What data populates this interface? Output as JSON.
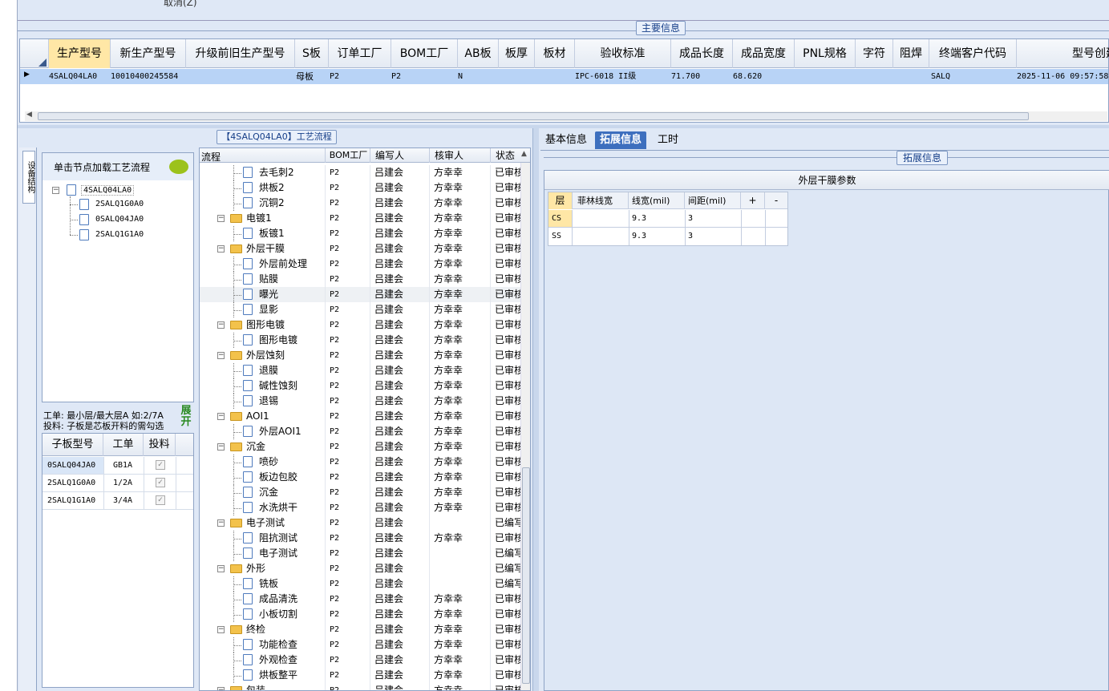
{
  "topbar": {
    "cancel_label": "取消(Z)"
  },
  "main_info": {
    "group_title": "主要信息",
    "columns": [
      "生产型号",
      "新生产型号",
      "升级前旧生产型号",
      "S板",
      "订单工厂",
      "BOM工厂",
      "AB板",
      "板厚",
      "板材",
      "验收标准",
      "成品长度",
      "成品宽度",
      "PNL规格",
      "字符",
      "阻焊",
      "终端客户代码",
      "型号创建日"
    ],
    "row": [
      "4SALQ04LA0",
      "10010400245584",
      "",
      "母板",
      "P2",
      "P2",
      "N",
      "",
      "",
      "IPC-6018 II级",
      "71.700",
      "68.620",
      "",
      "",
      "",
      "SALQ",
      "2025-11-06 09:57:58"
    ]
  },
  "flow_group_title": "【4SALQ04LA0】工艺流程",
  "left_panel": {
    "vertical_tab": "设备结构",
    "load_hint": "单击节点加载工艺流程",
    "tree": {
      "root": "4SALQ04LA0",
      "children": [
        "2SALQ1G0A0",
        "0SALQ04JA0",
        "2SALQ1G1A0"
      ]
    },
    "note_line1": "工单: 最小层/最大层A 如:2/7A",
    "note_line2": "投料: 子板是芯板开料的需勾选",
    "expand_label": "展开",
    "sub_columns": [
      "子板型号",
      "工单",
      "投料"
    ],
    "sub_rows": [
      {
        "model": "0SALQ04JA0",
        "order": "GB1A"
      },
      {
        "model": "2SALQ1G0A0",
        "order": "1/2A"
      },
      {
        "model": "2SALQ1G1A0",
        "order": "3/4A"
      }
    ]
  },
  "flow": {
    "columns": [
      "流程",
      "BOM工厂",
      "编写人",
      "核审人",
      "状态"
    ],
    "rows": [
      {
        "level": 2,
        "name": "去毛刺2",
        "bom": "P2",
        "writer": "吕建会",
        "reviewer": "方幸幸",
        "status": "已审核"
      },
      {
        "level": 2,
        "name": "烘板2",
        "bom": "P2",
        "writer": "吕建会",
        "reviewer": "方幸幸",
        "status": "已审核"
      },
      {
        "level": 2,
        "name": "沉铜2",
        "bom": "P2",
        "writer": "吕建会",
        "reviewer": "方幸幸",
        "status": "已审核"
      },
      {
        "level": 1,
        "name": "电镀1",
        "bom": "P2",
        "writer": "吕建会",
        "reviewer": "方幸幸",
        "status": "已审核"
      },
      {
        "level": 2,
        "name": "板镀1",
        "bom": "P2",
        "writer": "吕建会",
        "reviewer": "方幸幸",
        "status": "已审核"
      },
      {
        "level": 1,
        "name": "外层干膜",
        "bom": "P2",
        "writer": "吕建会",
        "reviewer": "方幸幸",
        "status": "已审核"
      },
      {
        "level": 2,
        "name": "外层前处理",
        "bom": "P2",
        "writer": "吕建会",
        "reviewer": "方幸幸",
        "status": "已审核"
      },
      {
        "level": 2,
        "name": "贴膜",
        "bom": "P2",
        "writer": "吕建会",
        "reviewer": "方幸幸",
        "status": "已审核"
      },
      {
        "level": 2,
        "name": "曝光",
        "bom": "P2",
        "writer": "吕建会",
        "reviewer": "方幸幸",
        "status": "已审核",
        "selected": true
      },
      {
        "level": 2,
        "name": "显影",
        "bom": "P2",
        "writer": "吕建会",
        "reviewer": "方幸幸",
        "status": "已审核"
      },
      {
        "level": 1,
        "name": "图形电镀",
        "bom": "P2",
        "writer": "吕建会",
        "reviewer": "方幸幸",
        "status": "已审核"
      },
      {
        "level": 2,
        "name": "图形电镀",
        "bom": "P2",
        "writer": "吕建会",
        "reviewer": "方幸幸",
        "status": "已审核"
      },
      {
        "level": 1,
        "name": "外层蚀刻",
        "bom": "P2",
        "writer": "吕建会",
        "reviewer": "方幸幸",
        "status": "已审核"
      },
      {
        "level": 2,
        "name": "退膜",
        "bom": "P2",
        "writer": "吕建会",
        "reviewer": "方幸幸",
        "status": "已审核"
      },
      {
        "level": 2,
        "name": "碱性蚀刻",
        "bom": "P2",
        "writer": "吕建会",
        "reviewer": "方幸幸",
        "status": "已审核"
      },
      {
        "level": 2,
        "name": "退锡",
        "bom": "P2",
        "writer": "吕建会",
        "reviewer": "方幸幸",
        "status": "已审核"
      },
      {
        "level": 1,
        "name": "AOI1",
        "bom": "P2",
        "writer": "吕建会",
        "reviewer": "方幸幸",
        "status": "已审核"
      },
      {
        "level": 2,
        "name": "外层AOI1",
        "bom": "P2",
        "writer": "吕建会",
        "reviewer": "方幸幸",
        "status": "已审核"
      },
      {
        "level": 1,
        "name": "沉金",
        "bom": "P2",
        "writer": "吕建会",
        "reviewer": "方幸幸",
        "status": "已审核"
      },
      {
        "level": 2,
        "name": "喷砂",
        "bom": "P2",
        "writer": "吕建会",
        "reviewer": "方幸幸",
        "status": "已审核"
      },
      {
        "level": 2,
        "name": "板边包胶",
        "bom": "P2",
        "writer": "吕建会",
        "reviewer": "方幸幸",
        "status": "已审核"
      },
      {
        "level": 2,
        "name": "沉金",
        "bom": "P2",
        "writer": "吕建会",
        "reviewer": "方幸幸",
        "status": "已审核"
      },
      {
        "level": 2,
        "name": "水洗烘干",
        "bom": "P2",
        "writer": "吕建会",
        "reviewer": "方幸幸",
        "status": "已审核"
      },
      {
        "level": 1,
        "name": "电子测试",
        "bom": "P2",
        "writer": "吕建会",
        "reviewer": "",
        "status": "已编写"
      },
      {
        "level": 2,
        "name": "阻抗测试",
        "bom": "P2",
        "writer": "吕建会",
        "reviewer": "方幸幸",
        "status": "已审核"
      },
      {
        "level": 2,
        "name": "电子测试",
        "bom": "P2",
        "writer": "吕建会",
        "reviewer": "",
        "status": "已编写"
      },
      {
        "level": 1,
        "name": "外形",
        "bom": "P2",
        "writer": "吕建会",
        "reviewer": "",
        "status": "已编写"
      },
      {
        "level": 2,
        "name": "铣板",
        "bom": "P2",
        "writer": "吕建会",
        "reviewer": "",
        "status": "已编写"
      },
      {
        "level": 2,
        "name": "成品清洗",
        "bom": "P2",
        "writer": "吕建会",
        "reviewer": "方幸幸",
        "status": "已审核"
      },
      {
        "level": 2,
        "name": "小板切割",
        "bom": "P2",
        "writer": "吕建会",
        "reviewer": "方幸幸",
        "status": "已审核"
      },
      {
        "level": 1,
        "name": "终检",
        "bom": "P2",
        "writer": "吕建会",
        "reviewer": "方幸幸",
        "status": "已审核"
      },
      {
        "level": 2,
        "name": "功能检查",
        "bom": "P2",
        "writer": "吕建会",
        "reviewer": "方幸幸",
        "status": "已审核"
      },
      {
        "level": 2,
        "name": "外观检查",
        "bom": "P2",
        "writer": "吕建会",
        "reviewer": "方幸幸",
        "status": "已审核"
      },
      {
        "level": 2,
        "name": "烘板整平",
        "bom": "P2",
        "writer": "吕建会",
        "reviewer": "方幸幸",
        "status": "已审核"
      },
      {
        "level": 1,
        "name": "包装",
        "bom": "P2",
        "writer": "吕建会",
        "reviewer": "方幸幸",
        "status": "已审核"
      }
    ]
  },
  "right": {
    "tabs": [
      "基本信息",
      "拓展信息",
      "工时"
    ],
    "active_tab": "拓展信息",
    "group_title": "拓展信息",
    "section_title": "外层干膜参数",
    "param_columns": [
      "层",
      "菲林线宽",
      "线宽(mil)",
      "间距(mil)",
      "+",
      "-"
    ],
    "param_rows": [
      {
        "layer": "CS",
        "film": "",
        "width": "9.3",
        "space": "3"
      },
      {
        "layer": "SS",
        "film": "",
        "width": "9.3",
        "space": "3"
      }
    ]
  }
}
